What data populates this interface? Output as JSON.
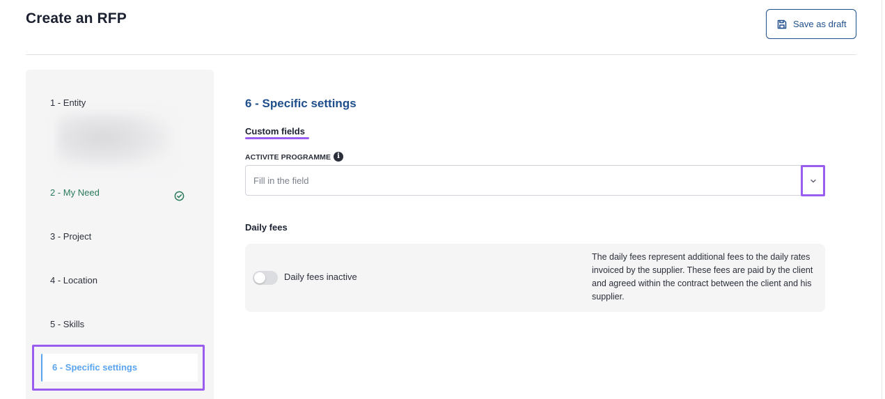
{
  "header": {
    "title": "Create an RFP",
    "save_draft_label": "Save as draft"
  },
  "sidebar": {
    "steps": [
      {
        "label": "1 - Entity",
        "status": "default"
      },
      {
        "label": "2 - My Need",
        "status": "completed"
      },
      {
        "label": "3 - Project",
        "status": "default"
      },
      {
        "label": "4 - Location",
        "status": "default"
      },
      {
        "label": "5 - Skills",
        "status": "default"
      },
      {
        "label": "6 - Specific settings",
        "status": "active"
      }
    ]
  },
  "main": {
    "section_title": "6 - Specific settings",
    "custom_fields_heading": "Custom fields",
    "activite_programme": {
      "label": "ACTIVITE PROGRAMME",
      "placeholder": "Fill in the field",
      "value": ""
    },
    "daily_fees": {
      "title": "Daily fees",
      "toggle_label": "Daily fees inactive",
      "toggle_on": false,
      "description": "The daily fees represent additional fees to the daily rates invoiced by the supplier. These fees are paid by the client and agreed within the contract between the client and his supplier."
    }
  },
  "colors": {
    "brand_blue": "#1e4f8c",
    "active_step_blue": "#5ba4ef",
    "highlight_purple": "#9b5cf0",
    "success_green": "#2a7a5a"
  },
  "icons": {
    "save": "floppy-disk-icon",
    "completed": "check-circle-icon",
    "info": "info-icon",
    "dropdown": "chevron-down-icon"
  }
}
